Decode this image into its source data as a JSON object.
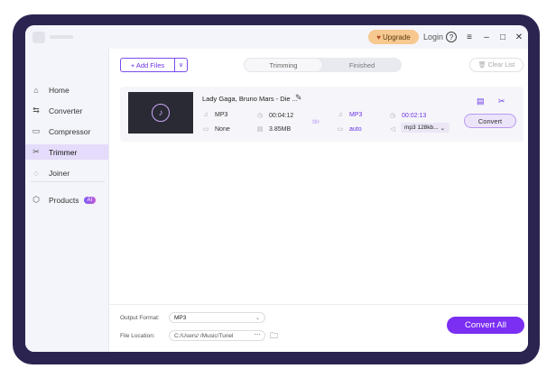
{
  "titlebar": {
    "upgrade_label": "Upgrade",
    "login_label": "Login",
    "help_icon": "?",
    "menu_icon": "≡",
    "minimize_icon": "–",
    "maximize_icon": "□",
    "close_icon": "✕"
  },
  "sidebar": {
    "items": [
      {
        "label": "Home",
        "icon": "home-icon",
        "glyph": "⌂",
        "active": false
      },
      {
        "label": "Converter",
        "icon": "converter-icon",
        "glyph": "⇆",
        "active": false
      },
      {
        "label": "Compressor",
        "icon": "compressor-icon",
        "glyph": "▭",
        "active": false
      },
      {
        "label": "Trimmer",
        "icon": "scissors-icon",
        "glyph": "✂",
        "active": true
      },
      {
        "label": "Joiner",
        "icon": "joiner-icon",
        "glyph": "◌",
        "active": false
      }
    ],
    "products_label": "Products",
    "products_badge": "AI"
  },
  "toolbar": {
    "add_files_label": "+ Add Files",
    "add_dropdown": "∨",
    "tab_trimming": "Trimming",
    "tab_finished": "Finished",
    "clear_list_label": "Clear List"
  },
  "file": {
    "name": "Lady Gaga, Bruno Mars - Die ...",
    "src_format": "MP3",
    "src_duration": "00:04:12",
    "src_subtitle": "None",
    "src_size": "3.85MB",
    "out_format": "MP3",
    "out_duration": "00:02:13",
    "out_subtitle": "auto",
    "out_quality": "mp3 128kb...",
    "convert_label": "Convert"
  },
  "footer": {
    "output_format_label": "Output Format:",
    "output_format_value": "MP3",
    "file_location_label": "File Location:",
    "file_location_value": "C:/Users/  /Music/Tunel",
    "dots": "···",
    "convert_all_label": "Convert All"
  },
  "colors": {
    "accent": "#7b2ff2",
    "frame": "#2c2450",
    "upgrade": "#f7c88f",
    "active_nav": "#e4dcfa"
  }
}
